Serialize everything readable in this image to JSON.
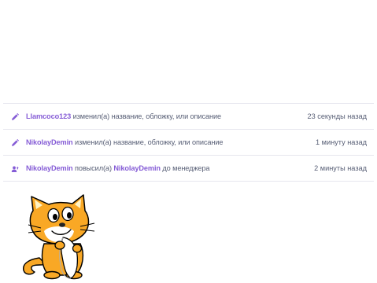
{
  "activity": {
    "rows": [
      {
        "icon": "pencil-icon",
        "user": "Llamcoco123",
        "action": " изменил(а) название, обложку, или описание",
        "time": "23 секунды назад"
      },
      {
        "icon": "pencil-icon",
        "user": "NikolayDemin",
        "action": " изменил(а) название, обложку, или описание",
        "time": "1 минуту назад"
      },
      {
        "icon": "promote-user-icon",
        "user": "NikolayDemin",
        "action_before": " повысил(а) ",
        "target_user": "NikolayDemin",
        "action_after": " до менеджера",
        "time": "2 минуты назад"
      }
    ]
  },
  "colors": {
    "link": "#855cd6",
    "text": "#575e75",
    "icon": "#855cd6",
    "divider": "#e6e6ee"
  },
  "mascot": {
    "icon": "scratch-cat-icon"
  }
}
